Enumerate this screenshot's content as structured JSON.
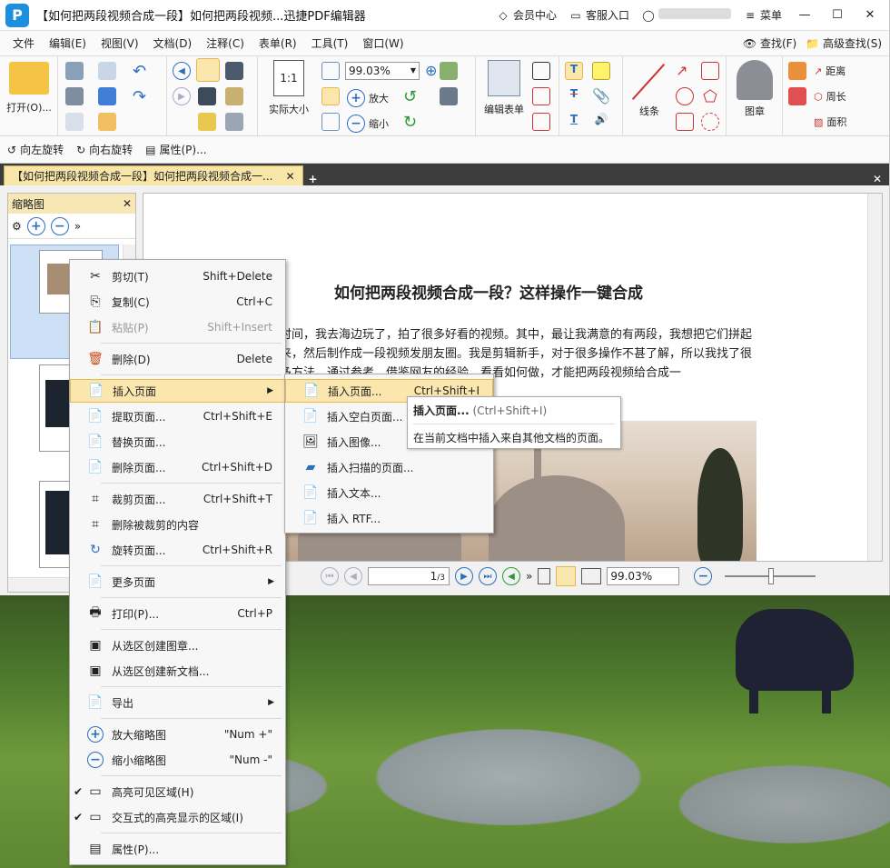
{
  "titlebar": {
    "title": "【如何把两段视频合成一段】如何把两段视频...迅捷PDF编辑器",
    "vip": "会员中心",
    "service": "客服入口",
    "menu": "菜单"
  },
  "menubar": {
    "items": [
      "文件",
      "编辑(E)",
      "视图(V)",
      "文档(D)",
      "注释(C)",
      "表单(R)",
      "工具(T)",
      "窗口(W)"
    ],
    "find": "查找(F)",
    "advfind": "高级查找(S)"
  },
  "ribbon": {
    "open": "打开(O)...",
    "actual": "实际大小",
    "zoom": "99.03%",
    "zoomin": "放大",
    "zoomout": "缩小",
    "editform": "编辑表单",
    "line": "线条",
    "stamp": "图章",
    "distance": "距离",
    "perimeter": "周长",
    "area": "面积"
  },
  "toolbar2": {
    "rotleft": "向左旋转",
    "rotright": "向右旋转",
    "props": "属性(P)..."
  },
  "tab": {
    "label": "【如何把两段视频合成一段】如何把两段视频合成一..."
  },
  "thumbs": {
    "title": "缩略图"
  },
  "doc": {
    "title": "如何把两段视频合成一段？这样操作一键合成",
    "para": "时间，我去海边玩了，拍了很多好看的视频。其中，最让我满意的有两段，我想把它们拼起来，然后制作成一段视频发朋友圈。我是剪辑新手，对于很多操作不甚了解，所以我找了很多方法。通过参考、借鉴网友的经验，看看如何做，才能把两段视频给合成一"
  },
  "status": {
    "page": "1",
    "total": "/3",
    "zoom": "99.03%"
  },
  "context": {
    "items": [
      {
        "label": "剪切(T)",
        "shortcut": "Shift+Delete",
        "icon": "scissors-icon"
      },
      {
        "label": "复制(C)",
        "shortcut": "Ctrl+C",
        "icon": "copy-icon"
      },
      {
        "label": "粘贴(P)",
        "shortcut": "Shift+Insert",
        "icon": "paste-icon"
      },
      {
        "label": "删除(D)",
        "shortcut": "Delete",
        "icon": "trash-icon"
      },
      {
        "label": "插入页面",
        "shortcut": "",
        "icon": "insert-page-icon"
      },
      {
        "label": "提取页面...",
        "shortcut": "Ctrl+Shift+E",
        "icon": "extract-icon"
      },
      {
        "label": "替换页面...",
        "shortcut": "",
        "icon": "replace-icon"
      },
      {
        "label": "删除页面...",
        "shortcut": "Ctrl+Shift+D",
        "icon": "delete-page-icon"
      },
      {
        "label": "裁剪页面...",
        "shortcut": "Ctrl+Shift+T",
        "icon": "crop-icon"
      },
      {
        "label": "删除被裁剪的内容",
        "shortcut": "",
        "icon": "crop-delete-icon"
      },
      {
        "label": "旋转页面...",
        "shortcut": "Ctrl+Shift+R",
        "icon": "rotate-icon"
      },
      {
        "label": "更多页面",
        "shortcut": "",
        "icon": "more-pages-icon"
      },
      {
        "label": "打印(P)...",
        "shortcut": "Ctrl+P",
        "icon": "printer-icon"
      },
      {
        "label": "从选区创建图章...",
        "shortcut": "",
        "icon": "stamp-create-icon"
      },
      {
        "label": "从选区创建新文档...",
        "shortcut": "",
        "icon": "newdoc-icon"
      },
      {
        "label": "导出",
        "shortcut": "",
        "icon": "export-icon"
      },
      {
        "label": "放大缩略图",
        "shortcut": "\"Num +\"",
        "icon": "zoom-in-icon"
      },
      {
        "label": "缩小缩略图",
        "shortcut": "\"Num -\"",
        "icon": "zoom-out-icon"
      },
      {
        "label": "高亮可见区域(H)",
        "shortcut": "",
        "icon": "highlight-icon"
      },
      {
        "label": "交互式的高亮显示的区域(I)",
        "shortcut": "",
        "icon": "interactive-highlight-icon"
      },
      {
        "label": "属性(P)...",
        "shortcut": "",
        "icon": "properties-icon"
      }
    ]
  },
  "submenu": {
    "items": [
      {
        "label": "插入页面...",
        "shortcut": "Ctrl+Shift+I"
      },
      {
        "label": "插入空白页面..."
      },
      {
        "label": "插入图像..."
      },
      {
        "label": "插入扫描的页面..."
      },
      {
        "label": "插入文本..."
      },
      {
        "label": "插入 RTF..."
      }
    ]
  },
  "tooltip": {
    "title": "插入页面...",
    "shortcut": "(Ctrl+Shift+I)",
    "desc": "在当前文档中插入来自其他文档的页面。"
  },
  "colors": {
    "accent": "#2c6fbf",
    "highlight": "#fbe7ad",
    "tab": "#f8e6a8"
  }
}
